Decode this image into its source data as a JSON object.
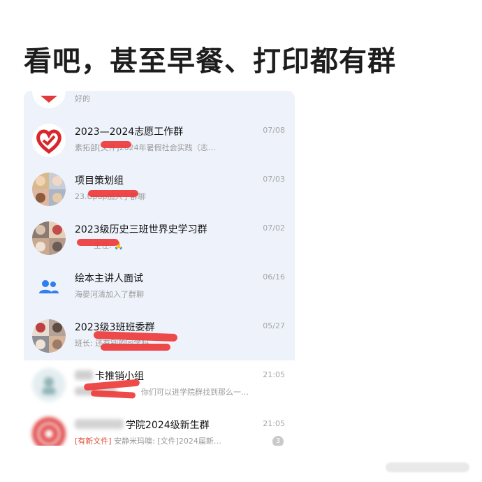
{
  "caption": "看吧，甚至早餐、打印都有群",
  "chats": [
    {
      "title": "",
      "time": "",
      "preview": "好的"
    },
    {
      "title": "2023—2024志愿工作群",
      "time": "07/08",
      "preview": "素拓部[文件]2024年暑假社会实践（志…"
    },
    {
      "title": "项目策划组",
      "time": "07/03",
      "preview": "23.Upup加入了群聊"
    },
    {
      "title": "2023级历史三班世界史学习群",
      "time": "07/02",
      "preview": "主任: 🙏"
    },
    {
      "title": "绘本主讲人面试",
      "time": "06/16",
      "preview": "海晏河清加入了群聊"
    },
    {
      "title": "2023级3班班委群",
      "time": "05/27",
      "preview": "班长: 还有别的同学吗，…"
    },
    {
      "title": "卡推销小组",
      "time": "21:05",
      "preview": "你们可以进学院群找到那么一…"
    },
    {
      "title": "学院2024级新生群",
      "time": "21:05",
      "preview_tag": "[有新文件]",
      "preview": "安静米玛噢: [文件]2024届新…",
      "badge": "3"
    }
  ],
  "colors": {
    "pinned_bg": "#eef3fb",
    "redaction": "#ee3b3b",
    "tag": "#e0583e"
  }
}
